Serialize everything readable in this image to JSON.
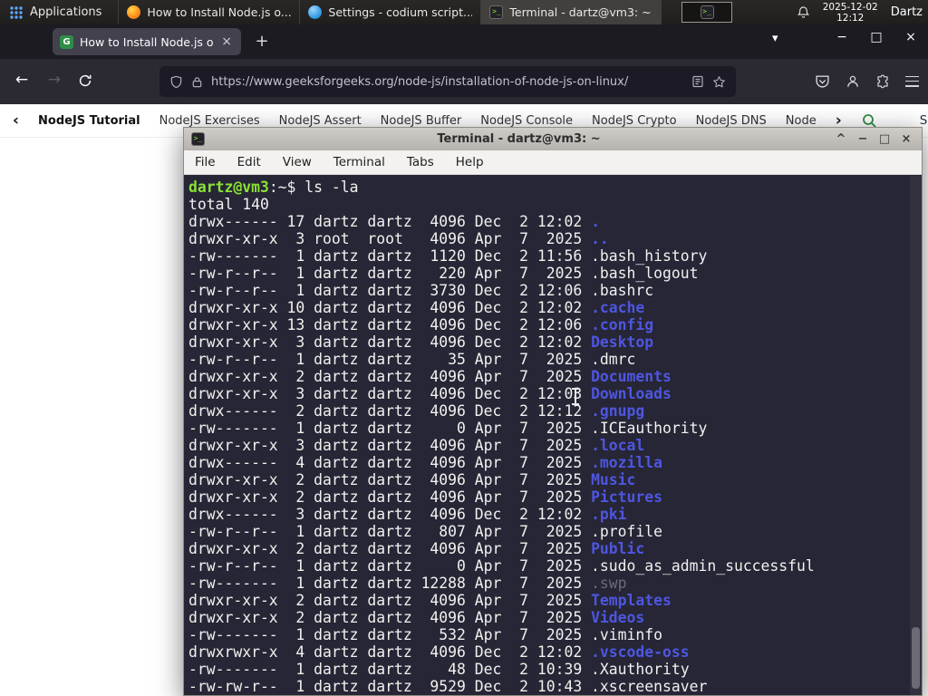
{
  "colors": {
    "gfg_green": "#2f8d46",
    "terminal_bg": "#262636",
    "terminal_fg": "#f1f1ef",
    "terminal_prompt_green": "#8ae234",
    "terminal_dir_blue": "#4e56e0",
    "terminal_dim": "#6b6b78",
    "firefox_toolbar": "#2b2a33",
    "taskbar_bg": "#232120"
  },
  "icons": {
    "back": "←",
    "forward": "→",
    "new_tab": "+",
    "list_tabs": "▾",
    "minimize": "−",
    "maximize": "□",
    "close": "×",
    "rollup": "^",
    "chevron_left": "‹",
    "chevron_right": "›",
    "terminal_glyph": ">_"
  },
  "taskbar": {
    "applications_label": "Applications",
    "windows": [
      {
        "title": "How to Install Node.js o..."
      },
      {
        "title": "Settings - codium script..."
      },
      {
        "title": "Terminal - dartz@vm3: ~"
      }
    ],
    "clock_date": "2025-12-02",
    "clock_time": "12:12",
    "user_label": "Dartz"
  },
  "browser": {
    "tab_title": "How to Install Node.js on...",
    "url": "https://www.geeksforgeeks.org/node-js/installation-of-node-js-on-linux/"
  },
  "gfg_nav": {
    "items": [
      "NodeJS Tutorial",
      "NodeJS Exercises",
      "NodeJS Assert",
      "NodeJS Buffer",
      "NodeJS Console",
      "NodeJS Crypto",
      "NodeJS DNS",
      "Node"
    ],
    "sign_in_label": "Sign In"
  },
  "terminal": {
    "window_title": "Terminal - dartz@vm3: ~",
    "menu": [
      "File",
      "Edit",
      "View",
      "Terminal",
      "Tabs",
      "Help"
    ],
    "lines": [
      {
        "segments": [
          {
            "text": "dartz@vm3",
            "color": "green"
          },
          {
            "text": ":~$ ls -la",
            "color": "fg"
          }
        ]
      },
      {
        "segments": [
          {
            "text": "total 140",
            "color": "fg"
          }
        ]
      },
      {
        "segments": [
          {
            "text": "drwx------ 17 dartz dartz  4096 Dec  2 12:02 ",
            "color": "fg"
          },
          {
            "text": ".",
            "color": "dir"
          }
        ]
      },
      {
        "segments": [
          {
            "text": "drwxr-xr-x  3 root  root   4096 Apr  7  2025 ",
            "color": "fg"
          },
          {
            "text": "..",
            "color": "dir"
          }
        ]
      },
      {
        "segments": [
          {
            "text": "-rw-------  1 dartz dartz  1120 Dec  2 11:56 .bash_history",
            "color": "fg"
          }
        ]
      },
      {
        "segments": [
          {
            "text": "-rw-r--r--  1 dartz dartz   220 Apr  7  2025 .bash_logout",
            "color": "fg"
          }
        ]
      },
      {
        "segments": [
          {
            "text": "-rw-r--r--  1 dartz dartz  3730 Dec  2 12:06 .bashrc",
            "color": "fg"
          }
        ]
      },
      {
        "segments": [
          {
            "text": "drwxr-xr-x 10 dartz dartz  4096 Dec  2 12:02 ",
            "color": "fg"
          },
          {
            "text": ".cache",
            "color": "dir"
          }
        ]
      },
      {
        "segments": [
          {
            "text": "drwxr-xr-x 13 dartz dartz  4096 Dec  2 12:06 ",
            "color": "fg"
          },
          {
            "text": ".config",
            "color": "dir"
          }
        ]
      },
      {
        "segments": [
          {
            "text": "drwxr-xr-x  3 dartz dartz  4096 Dec  2 12:02 ",
            "color": "fg"
          },
          {
            "text": "Desktop",
            "color": "dir"
          }
        ]
      },
      {
        "segments": [
          {
            "text": "-rw-r--r--  1 dartz dartz    35 Apr  7  2025 .dmrc",
            "color": "fg"
          }
        ]
      },
      {
        "segments": [
          {
            "text": "drwxr-xr-x  2 dartz dartz  4096 Apr  7  2025 ",
            "color": "fg"
          },
          {
            "text": "Documents",
            "color": "dir"
          }
        ]
      },
      {
        "segments": [
          {
            "text": "drwxr-xr-x  3 dartz dartz  4096 Dec  2 12:03 ",
            "color": "fg"
          },
          {
            "text": "Downloads",
            "color": "dir"
          }
        ]
      },
      {
        "segments": [
          {
            "text": "drwx------  2 dartz dartz  4096 Dec  2 12:12 ",
            "color": "fg"
          },
          {
            "text": ".gnupg",
            "color": "dir"
          }
        ]
      },
      {
        "segments": [
          {
            "text": "-rw-------  1 dartz dartz     0 Apr  7  2025 .ICEauthority",
            "color": "fg"
          }
        ]
      },
      {
        "segments": [
          {
            "text": "drwxr-xr-x  3 dartz dartz  4096 Apr  7  2025 ",
            "color": "fg"
          },
          {
            "text": ".local",
            "color": "dir"
          }
        ]
      },
      {
        "segments": [
          {
            "text": "drwx------  4 dartz dartz  4096 Apr  7  2025 ",
            "color": "fg"
          },
          {
            "text": ".mozilla",
            "color": "dir"
          }
        ]
      },
      {
        "segments": [
          {
            "text": "drwxr-xr-x  2 dartz dartz  4096 Apr  7  2025 ",
            "color": "fg"
          },
          {
            "text": "Music",
            "color": "dir"
          }
        ]
      },
      {
        "segments": [
          {
            "text": "drwxr-xr-x  2 dartz dartz  4096 Apr  7  2025 ",
            "color": "fg"
          },
          {
            "text": "Pictures",
            "color": "dir"
          }
        ]
      },
      {
        "segments": [
          {
            "text": "drwx------  3 dartz dartz  4096 Dec  2 12:02 ",
            "color": "fg"
          },
          {
            "text": ".pki",
            "color": "dir"
          }
        ]
      },
      {
        "segments": [
          {
            "text": "-rw-r--r--  1 dartz dartz   807 Apr  7  2025 .profile",
            "color": "fg"
          }
        ]
      },
      {
        "segments": [
          {
            "text": "drwxr-xr-x  2 dartz dartz  4096 Apr  7  2025 ",
            "color": "fg"
          },
          {
            "text": "Public",
            "color": "dir"
          }
        ]
      },
      {
        "segments": [
          {
            "text": "-rw-r--r--  1 dartz dartz     0 Apr  7  2025 .sudo_as_admin_successful",
            "color": "fg"
          }
        ]
      },
      {
        "segments": [
          {
            "text": "-rw-------  1 dartz dartz 12288 Apr  7  2025 ",
            "color": "fg"
          },
          {
            "text": ".swp",
            "color": "dim"
          }
        ]
      },
      {
        "segments": [
          {
            "text": "drwxr-xr-x  2 dartz dartz  4096 Apr  7  2025 ",
            "color": "fg"
          },
          {
            "text": "Templates",
            "color": "dir"
          }
        ]
      },
      {
        "segments": [
          {
            "text": "drwxr-xr-x  2 dartz dartz  4096 Apr  7  2025 ",
            "color": "fg"
          },
          {
            "text": "Videos",
            "color": "dir"
          }
        ]
      },
      {
        "segments": [
          {
            "text": "-rw-------  1 dartz dartz   532 Apr  7  2025 .viminfo",
            "color": "fg"
          }
        ]
      },
      {
        "segments": [
          {
            "text": "drwxrwxr-x  4 dartz dartz  4096 Dec  2 12:02 ",
            "color": "fg"
          },
          {
            "text": ".vscode-oss",
            "color": "dir"
          }
        ]
      },
      {
        "segments": [
          {
            "text": "-rw-------  1 dartz dartz    48 Dec  2 10:39 .Xauthority",
            "color": "fg"
          }
        ]
      },
      {
        "segments": [
          {
            "text": "-rw-rw-r--  1 dartz dartz  9529 Dec  2 10:43 .xscreensaver",
            "color": "fg"
          }
        ]
      }
    ]
  }
}
